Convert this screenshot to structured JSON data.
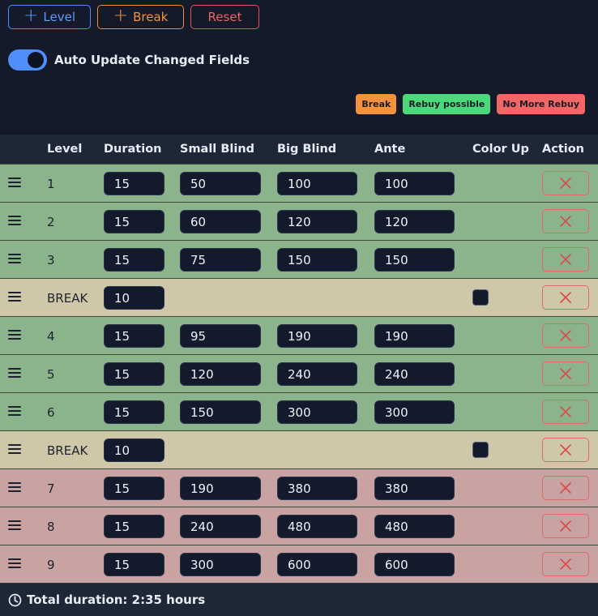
{
  "toolbar": {
    "level_label": "Level",
    "break_label": "Break",
    "reset_label": "Reset"
  },
  "auto_update": {
    "label": "Auto Update Changed Fields",
    "enabled": true
  },
  "legend": {
    "break": "Break",
    "rebuy": "Rebuy possible",
    "no_more_rebuy": "No More Rebuy"
  },
  "colors": {
    "accent_blue": "#4f8ff7",
    "break_orange": "#f5923e",
    "rebuy_green": "#4cd97b",
    "no_rebuy_red": "#f26666"
  },
  "table": {
    "headers": {
      "level": "Level",
      "duration": "Duration",
      "small_blind": "Small Blind",
      "big_blind": "Big Blind",
      "ante": "Ante",
      "color_up": "Color Up",
      "action": "Action"
    },
    "rows": [
      {
        "type": "level",
        "status": "green",
        "level": "1",
        "duration": "15",
        "small_blind": "50",
        "big_blind": "100",
        "ante": "100"
      },
      {
        "type": "level",
        "status": "green",
        "level": "2",
        "duration": "15",
        "small_blind": "60",
        "big_blind": "120",
        "ante": "120"
      },
      {
        "type": "level",
        "status": "green",
        "level": "3",
        "duration": "15",
        "small_blind": "75",
        "big_blind": "150",
        "ante": "150"
      },
      {
        "type": "break",
        "status": "tan",
        "level": "BREAK",
        "duration": "10",
        "color_up": false
      },
      {
        "type": "level",
        "status": "green",
        "level": "4",
        "duration": "15",
        "small_blind": "95",
        "big_blind": "190",
        "ante": "190"
      },
      {
        "type": "level",
        "status": "green",
        "level": "5",
        "duration": "15",
        "small_blind": "120",
        "big_blind": "240",
        "ante": "240"
      },
      {
        "type": "level",
        "status": "green",
        "level": "6",
        "duration": "15",
        "small_blind": "150",
        "big_blind": "300",
        "ante": "300"
      },
      {
        "type": "break",
        "status": "tan",
        "level": "BREAK",
        "duration": "10",
        "color_up": false
      },
      {
        "type": "level",
        "status": "red",
        "level": "7",
        "duration": "15",
        "small_blind": "190",
        "big_blind": "380",
        "ante": "380"
      },
      {
        "type": "level",
        "status": "red",
        "level": "8",
        "duration": "15",
        "small_blind": "240",
        "big_blind": "480",
        "ante": "480"
      },
      {
        "type": "level",
        "status": "red",
        "level": "9",
        "duration": "15",
        "small_blind": "300",
        "big_blind": "600",
        "ante": "600"
      }
    ]
  },
  "footer": {
    "total": "Total duration: 2:35 hours"
  }
}
